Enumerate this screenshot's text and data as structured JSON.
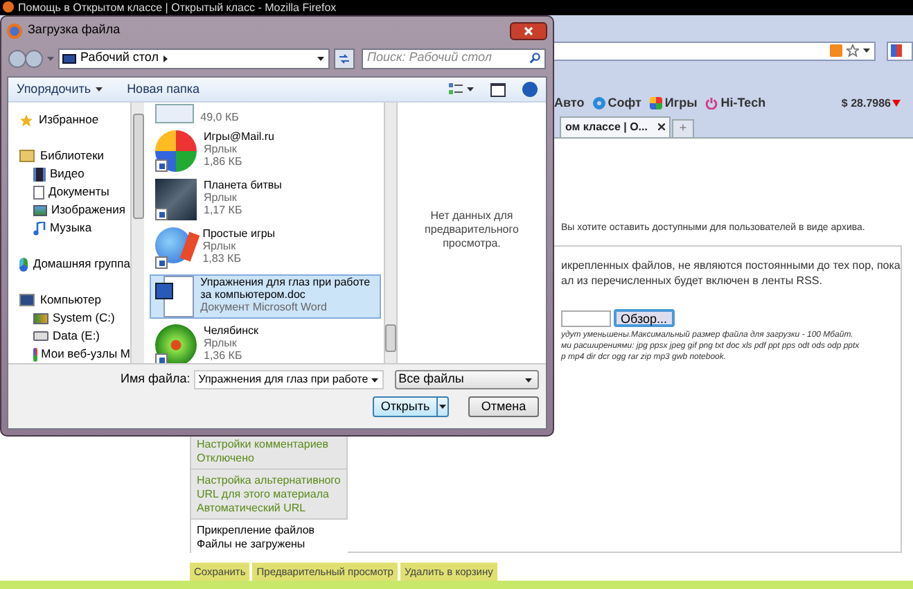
{
  "browser": {
    "title": "Помощь в Открытом классе | Открытый класс - Mozilla Firefox",
    "bookmarks": [
      "Авто",
      "Софт",
      "Игры",
      "Hi-Tech"
    ],
    "rate": "$ 28.7986",
    "tabs": [
      {
        "label": "ом классе | О...",
        "selected": true
      }
    ],
    "new_tab": "+",
    "notice": "Вы хотите оставить доступными для пользователей в виде архива.",
    "info": [
      "икрепленных файлов, не являются постоянными до тех пор, пока",
      "ал из перечисленных будет включен в ленты RSS."
    ],
    "browse_button": "Обзор...",
    "hints": [
      "удут уменьшены.Максимальный размер файла для загрузки - 100 Мбайт.",
      "ми расширениями: jpg ppsx jpeg gif png txt doc xls pdf ppt pps odt ods odp pptx",
      "p mp4 dir dcr ogg rar zip mp3 gwb notebook."
    ],
    "settings": [
      {
        "title": "Настройки комментариев",
        "value": "Отключено",
        "selected": false
      },
      {
        "title": "Настройка альтернативного URL для этого материала",
        "value": "Автоматический URL",
        "selected": false
      },
      {
        "title": "Прикрепление файлов",
        "value": "Файлы не загружены",
        "selected": true
      }
    ],
    "actions": [
      "Сохранить",
      "Предварительный просмотр",
      "Удалить в корзину"
    ]
  },
  "dialog": {
    "title": "Загрузка файла",
    "location": "Рабочий стол",
    "search_placeholder": "Поиск: Рабочий стол",
    "toolbar": [
      "Упорядочить",
      "Новая папка"
    ],
    "nav": [
      {
        "label": "Избранное"
      },
      {
        "label": "Библиотеки",
        "children": [
          {
            "label": "Видео"
          },
          {
            "label": "Документы"
          },
          {
            "label": "Изображения"
          },
          {
            "label": "Музыка"
          }
        ]
      },
      {
        "label": "Домашняя группа"
      },
      {
        "label": "Компьютер",
        "children": [
          {
            "label": "System (C:)"
          },
          {
            "label": "Data (E:)"
          },
          {
            "label": "Мои веб-узлы M"
          }
        ]
      }
    ],
    "files": [
      {
        "size": "49,0 КБ",
        "selected": false
      },
      {
        "name": "Игры@Mail.ru",
        "type": "Ярлык",
        "size": "1,86 КБ",
        "selected": false
      },
      {
        "name": "Планета битвы",
        "type": "Ярлык",
        "size": "1,17 КБ",
        "selected": false
      },
      {
        "name": "Простые игры",
        "type": "Ярлык",
        "size": "1,83 КБ",
        "selected": false
      },
      {
        "name": "Упражнения для глаз при работе за компьютером.doc",
        "type": "Документ Microsoft Word",
        "selected": true
      },
      {
        "name": "Челябинск",
        "type": "Ярлык",
        "size": "1,36 КБ",
        "selected": false
      }
    ],
    "preview": "Нет данных для предварительного просмотра.",
    "filename_label": "Имя файла:",
    "filename": "Упражнения для глаз при работе",
    "filetype": "Все файлы",
    "open_button": "Открыть",
    "cancel_button": "Отмена"
  }
}
